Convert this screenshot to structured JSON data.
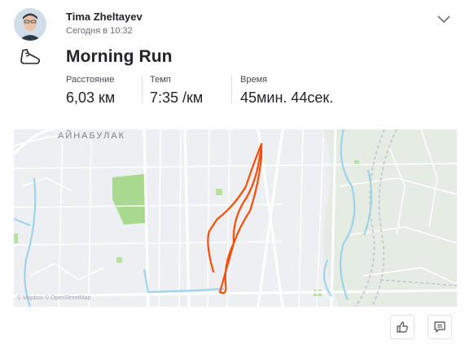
{
  "header": {
    "author": "Tima Zheltayev",
    "timestamp": "Сегодня в 10:32"
  },
  "activity": {
    "title": "Morning Run",
    "sport_icon": "running-shoe-icon"
  },
  "stats": [
    {
      "label": "Расстояние",
      "value": "6,03 км"
    },
    {
      "label": "Темп",
      "value": "7:35 /км"
    },
    {
      "label": "Время",
      "value": "45мин. 44сек."
    }
  ],
  "map": {
    "place_label": "АЙНАБУЛАК",
    "attribution": "© Mapbox © OpenStreetMap",
    "route_color": "#fc4c02"
  },
  "actions": {
    "kudos_icon": "thumbs-up-icon",
    "comment_icon": "comment-icon"
  },
  "colors": {
    "accent": "#fc4c02",
    "text": "#242428",
    "muted": "#6d6d78"
  }
}
